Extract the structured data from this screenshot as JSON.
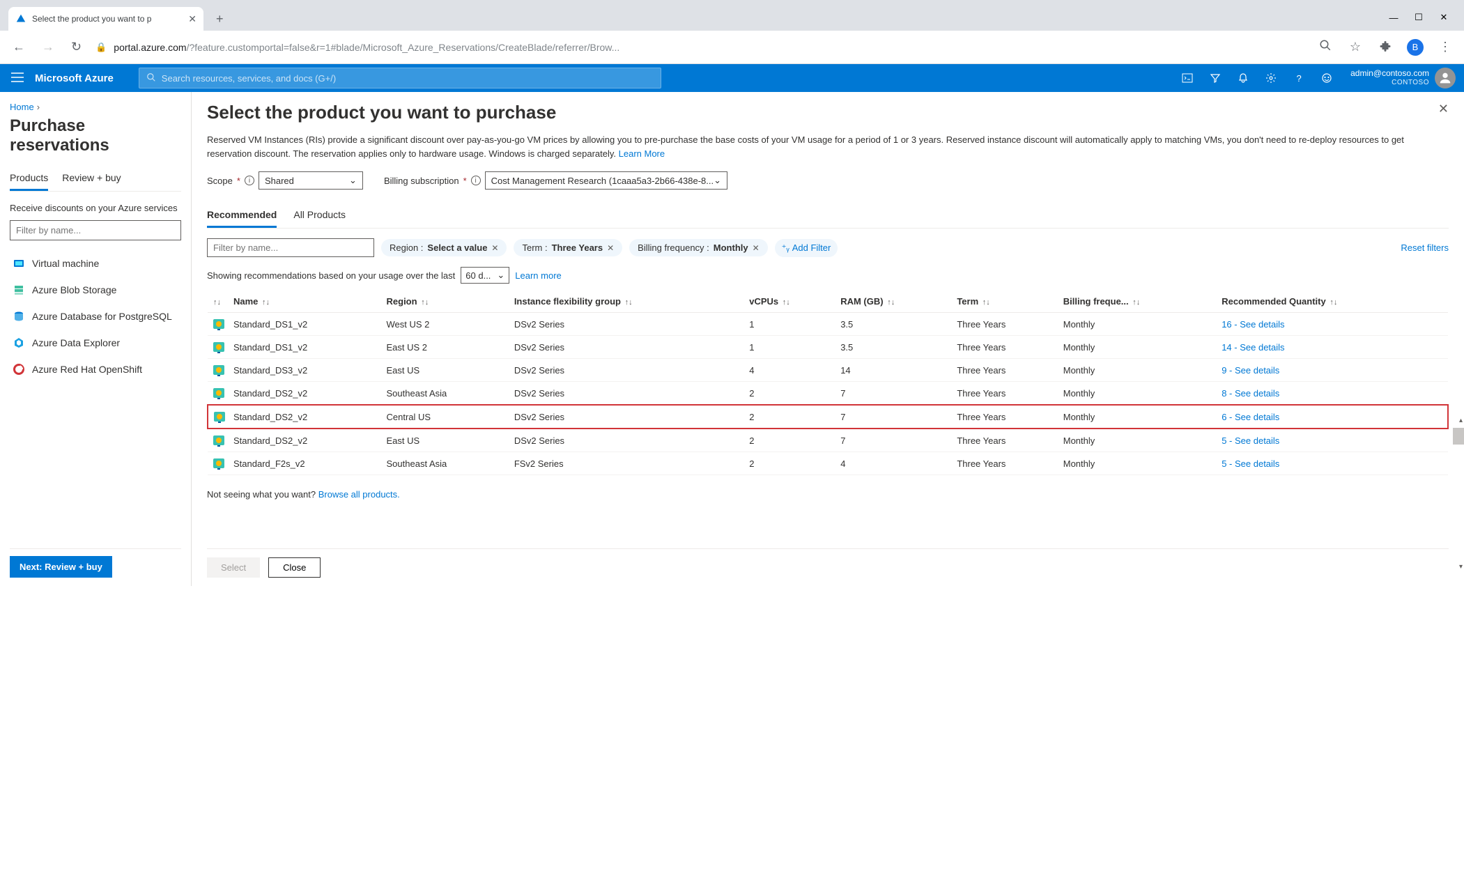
{
  "browser": {
    "tab_title": "Select the product you want to p",
    "new_tab": "+",
    "url_prefix": "portal.azure.com",
    "url_rest": "/?feature.customportal=false&r=1#blade/Microsoft_Azure_Reservations/CreateBlade/referrer/Brow...",
    "profile_letter": "B"
  },
  "azure_bar": {
    "logo": "Microsoft Azure",
    "search_placeholder": "Search resources, services, and docs (G+/)",
    "user_email": "admin@contoso.com",
    "tenant": "CONTOSO"
  },
  "left": {
    "breadcrumb": "Home",
    "title": "Purchase reservations",
    "tab_products": "Products",
    "tab_review": "Review + buy",
    "subtext": "Receive discounts on your Azure services",
    "filter_placeholder": "Filter by name...",
    "services": [
      "Virtual machine",
      "Azure Blob Storage",
      "Azure Database for PostgreSQL",
      "Azure Data Explorer",
      "Azure Red Hat OpenShift"
    ],
    "next_btn": "Next: Review + buy"
  },
  "blade": {
    "title": "Select the product you want to purchase",
    "desc": "Reserved VM Instances (RIs) provide a significant discount over pay-as-you-go VM prices by allowing you to pre-purchase the base costs of your VM usage for a period of 1 or 3 years. Reserved instance discount will automatically apply to matching VMs, you don't need to re-deploy resources to get reservation discount. The reservation applies only to hardware usage. Windows is charged separately. ",
    "learn_more": "Learn More",
    "scope_label": "Scope",
    "scope_value": "Shared",
    "billing_label": "Billing subscription",
    "billing_value": "Cost Management Research (1caaa5a3-2b66-438e-8...",
    "tab_recommended": "Recommended",
    "tab_all": "All Products",
    "name_filter_placeholder": "Filter by name...",
    "pill_region": "Region : ",
    "pill_region_v": "Select a value",
    "pill_term": "Term : ",
    "pill_term_v": "Three Years",
    "pill_freq": "Billing frequency : ",
    "pill_freq_v": "Monthly",
    "add_filter": "Add Filter",
    "reset": "Reset filters",
    "usage_text_pre": "Showing recommendations based on your usage over the last",
    "usage_days": "60 d...",
    "usage_learn": "Learn more",
    "columns": {
      "name": "Name",
      "region": "Region",
      "flex": "Instance flexibility group",
      "vcpus": "vCPUs",
      "ram": "RAM (GB)",
      "term": "Term",
      "freq": "Billing freque...",
      "qty": "Recommended Quantity"
    },
    "rows": [
      {
        "name": "Standard_DS1_v2",
        "region": "West US 2",
        "flex": "DSv2 Series",
        "vcpus": "1",
        "ram": "3.5",
        "term": "Three Years",
        "freq": "Monthly",
        "qty": "16 - See details",
        "hl": false
      },
      {
        "name": "Standard_DS1_v2",
        "region": "East US 2",
        "flex": "DSv2 Series",
        "vcpus": "1",
        "ram": "3.5",
        "term": "Three Years",
        "freq": "Monthly",
        "qty": "14 - See details",
        "hl": false
      },
      {
        "name": "Standard_DS3_v2",
        "region": "East US",
        "flex": "DSv2 Series",
        "vcpus": "4",
        "ram": "14",
        "term": "Three Years",
        "freq": "Monthly",
        "qty": "9 - See details",
        "hl": false
      },
      {
        "name": "Standard_DS2_v2",
        "region": "Southeast Asia",
        "flex": "DSv2 Series",
        "vcpus": "2",
        "ram": "7",
        "term": "Three Years",
        "freq": "Monthly",
        "qty": "8 - See details",
        "hl": false
      },
      {
        "name": "Standard_DS2_v2",
        "region": "Central US",
        "flex": "DSv2 Series",
        "vcpus": "2",
        "ram": "7",
        "term": "Three Years",
        "freq": "Monthly",
        "qty": "6 - See details",
        "hl": true
      },
      {
        "name": "Standard_DS2_v2",
        "region": "East US",
        "flex": "DSv2 Series",
        "vcpus": "2",
        "ram": "7",
        "term": "Three Years",
        "freq": "Monthly",
        "qty": "5 - See details",
        "hl": false
      },
      {
        "name": "Standard_F2s_v2",
        "region": "Southeast Asia",
        "flex": "FSv2 Series",
        "vcpus": "2",
        "ram": "4",
        "term": "Three Years",
        "freq": "Monthly",
        "qty": "5 - See details",
        "hl": false
      }
    ],
    "not_seeing": "Not seeing what you want? ",
    "browse_all": "Browse all products.",
    "btn_select": "Select",
    "btn_close": "Close"
  }
}
